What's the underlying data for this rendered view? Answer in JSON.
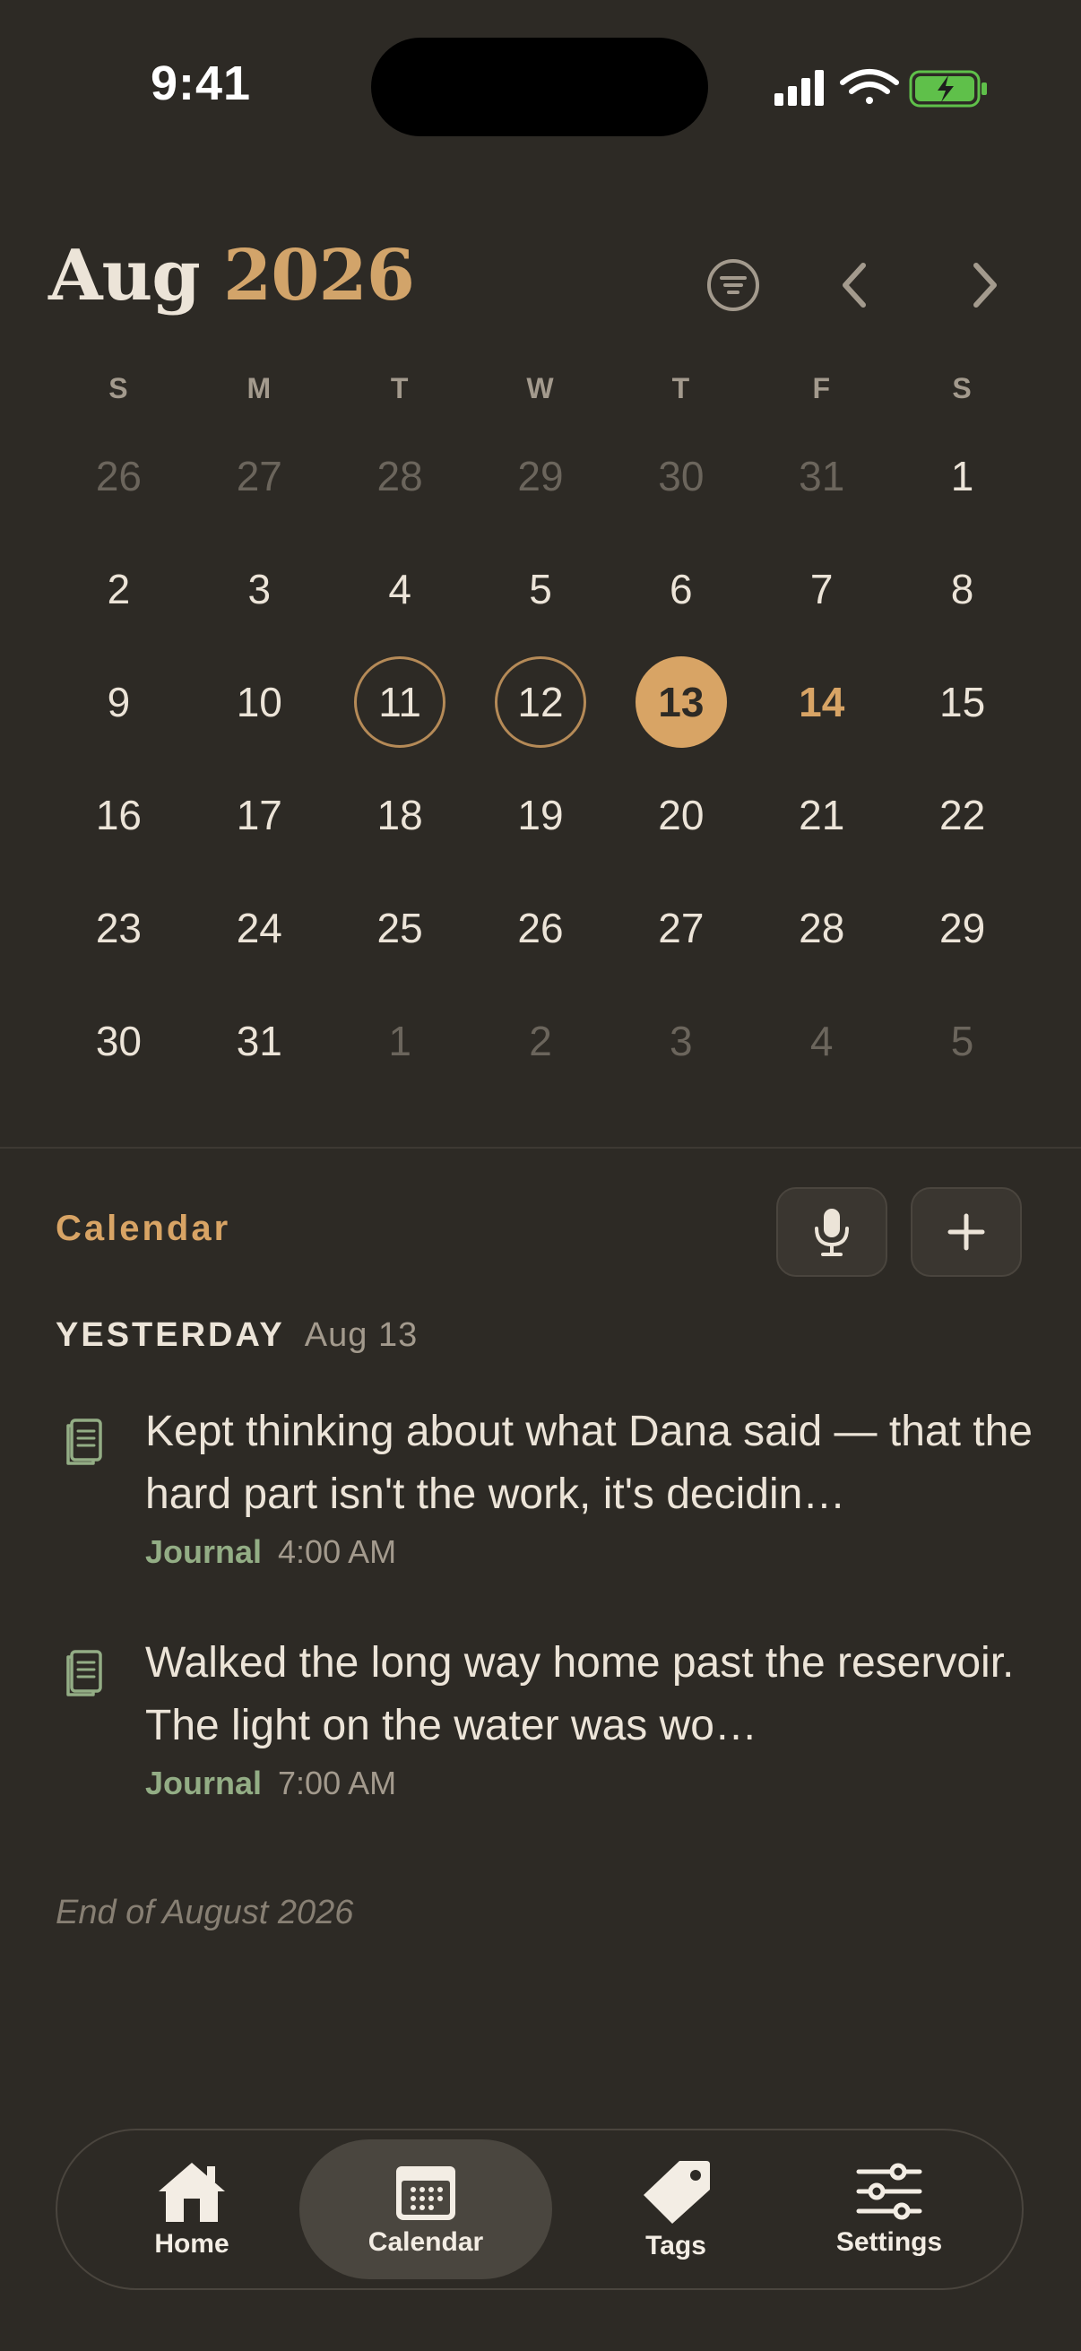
{
  "status": {
    "time": "9:41"
  },
  "header": {
    "month": "Aug",
    "year": "2026"
  },
  "weekdays": [
    "S",
    "M",
    "T",
    "W",
    "T",
    "F",
    "S"
  ],
  "weeks": [
    [
      {
        "d": "26",
        "s": "muted"
      },
      {
        "d": "27",
        "s": "muted"
      },
      {
        "d": "28",
        "s": "muted"
      },
      {
        "d": "29",
        "s": "muted"
      },
      {
        "d": "30",
        "s": "muted"
      },
      {
        "d": "31",
        "s": "muted"
      },
      {
        "d": "1",
        "s": ""
      }
    ],
    [
      {
        "d": "2",
        "s": ""
      },
      {
        "d": "3",
        "s": ""
      },
      {
        "d": "4",
        "s": ""
      },
      {
        "d": "5",
        "s": ""
      },
      {
        "d": "6",
        "s": ""
      },
      {
        "d": "7",
        "s": ""
      },
      {
        "d": "8",
        "s": ""
      }
    ],
    [
      {
        "d": "9",
        "s": ""
      },
      {
        "d": "10",
        "s": ""
      },
      {
        "d": "11",
        "s": "ring"
      },
      {
        "d": "12",
        "s": "ring"
      },
      {
        "d": "13",
        "s": "today"
      },
      {
        "d": "14",
        "s": "accent"
      },
      {
        "d": "15",
        "s": ""
      }
    ],
    [
      {
        "d": "16",
        "s": ""
      },
      {
        "d": "17",
        "s": ""
      },
      {
        "d": "18",
        "s": ""
      },
      {
        "d": "19",
        "s": ""
      },
      {
        "d": "20",
        "s": ""
      },
      {
        "d": "21",
        "s": ""
      },
      {
        "d": "22",
        "s": ""
      }
    ],
    [
      {
        "d": "23",
        "s": ""
      },
      {
        "d": "24",
        "s": ""
      },
      {
        "d": "25",
        "s": ""
      },
      {
        "d": "26",
        "s": ""
      },
      {
        "d": "27",
        "s": ""
      },
      {
        "d": "28",
        "s": ""
      },
      {
        "d": "29",
        "s": ""
      }
    ],
    [
      {
        "d": "30",
        "s": ""
      },
      {
        "d": "31",
        "s": ""
      },
      {
        "d": "1",
        "s": "muted"
      },
      {
        "d": "2",
        "s": "muted"
      },
      {
        "d": "3",
        "s": "muted"
      },
      {
        "d": "4",
        "s": "muted"
      },
      {
        "d": "5",
        "s": "muted"
      }
    ]
  ],
  "section": {
    "title": "Calendar"
  },
  "group": {
    "label": "YESTERDAY",
    "date": "Aug 13"
  },
  "entries": [
    {
      "text": "Kept thinking about what Dana said — that the hard part isn't the work, it's decidin…",
      "kind": "Journal",
      "time": "4:00 AM"
    },
    {
      "text": "Walked the long way home past the reservoir. The light on the water was wo…",
      "kind": "Journal",
      "time": "7:00 AM"
    }
  ],
  "end_note": "End of August 2026",
  "tabs": [
    {
      "label": "Home",
      "icon": "house-icon"
    },
    {
      "label": "Calendar",
      "icon": "calendar-icon",
      "active": true
    },
    {
      "label": "Tags",
      "icon": "tag-icon"
    },
    {
      "label": "Settings",
      "icon": "sliders-icon"
    }
  ],
  "colors": {
    "background": "#2d2a25",
    "accent": "#d8a465",
    "journal": "#93ad85",
    "battery": "#5fc04a"
  }
}
